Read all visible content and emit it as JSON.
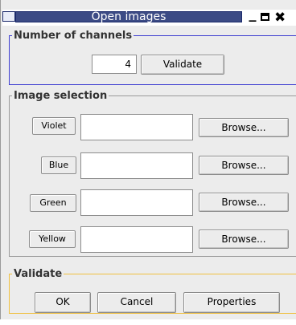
{
  "window": {
    "title": "Open images"
  },
  "channels": {
    "legend": "Number of channels",
    "value": "4",
    "validate_label": "Validate"
  },
  "image_selection": {
    "legend": "Image selection",
    "rows": [
      {
        "label": "Violet",
        "path": "",
        "browse_label": "Browse..."
      },
      {
        "label": "Blue",
        "path": "",
        "browse_label": "Browse..."
      },
      {
        "label": "Green",
        "path": "",
        "browse_label": "Browse..."
      },
      {
        "label": "Yellow",
        "path": "",
        "browse_label": "Browse..."
      }
    ]
  },
  "validate": {
    "legend": "Validate",
    "ok_label": "OK",
    "cancel_label": "Cancel",
    "properties_label": "Properties"
  },
  "colors": {
    "titlebar": "#3c4b85",
    "active_group_border": "#3c3cd0",
    "validate_group_border": "#f0c040"
  }
}
